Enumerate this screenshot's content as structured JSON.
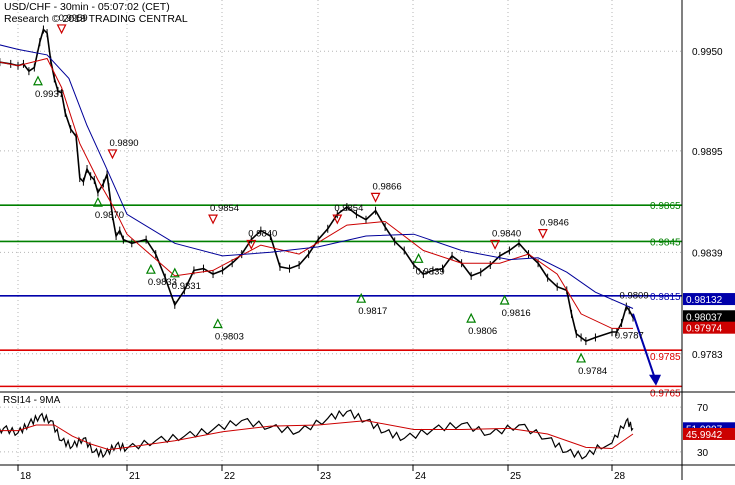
{
  "header": {
    "line1": "USD/CHF - 30min - 05:07:02 (CET)",
    "line2": "Research © 2018 TRADING CENTRAL"
  },
  "colors": {
    "support": "#008000",
    "pivot": "#0000aa",
    "resistance_red": "#dd0000",
    "ema_fast": "#cc0000",
    "ema_slow": "#000099",
    "price": "#000000",
    "grid": "#b5b5b5",
    "current_tag": "#000000",
    "red_tag": "#cc0000",
    "blue_tag": "#0000aa",
    "rsi_tag": "#0000aa",
    "rsi_ma_tag": "#cc0000"
  },
  "chart_data": [
    {
      "type": "line",
      "name": "price",
      "ylim": [
        0.9763,
        0.997
      ],
      "y_ticks": [
        "0.9950",
        "0.9895",
        "0.9839",
        "0.9783"
      ],
      "x_ticks": [
        "18",
        "21",
        "22",
        "23",
        "24",
        "25",
        "28"
      ],
      "price_path": [
        [
          17.0,
          0.9945
        ],
        [
          17.2,
          0.9948
        ],
        [
          17.5,
          0.9944
        ],
        [
          17.8,
          0.9943
        ],
        [
          18.0,
          0.9942
        ],
        [
          18.15,
          0.9943
        ],
        [
          18.3,
          0.9939
        ],
        [
          18.45,
          0.9941
        ],
        [
          18.6,
          0.9955
        ],
        [
          18.7,
          0.9962
        ],
        [
          18.8,
          0.996
        ],
        [
          18.9,
          0.9945
        ],
        [
          19.0,
          0.9935
        ],
        [
          19.1,
          0.9928
        ],
        [
          19.2,
          0.9927
        ],
        [
          19.3,
          0.9916
        ],
        [
          19.45,
          0.9907
        ],
        [
          19.6,
          0.9903
        ],
        [
          19.7,
          0.988
        ],
        [
          19.8,
          0.9878
        ],
        [
          19.9,
          0.9885
        ],
        [
          20.0,
          0.9881
        ],
        [
          20.1,
          0.9879
        ],
        [
          20.2,
          0.9872
        ],
        [
          20.35,
          0.9877
        ],
        [
          20.45,
          0.9882
        ],
        [
          20.5,
          0.9875
        ],
        [
          20.6,
          0.9859
        ],
        [
          20.7,
          0.9848
        ],
        [
          20.8,
          0.9851
        ],
        [
          20.9,
          0.9846
        ],
        [
          21.05,
          0.9844
        ],
        [
          21.2,
          0.9846
        ],
        [
          21.3,
          0.9838
        ],
        [
          21.4,
          0.9825
        ],
        [
          21.5,
          0.981
        ],
        [
          21.6,
          0.9818
        ],
        [
          21.7,
          0.9829
        ],
        [
          21.8,
          0.983
        ],
        [
          21.9,
          0.9827
        ],
        [
          22.0,
          0.9829
        ],
        [
          22.1,
          0.9833
        ],
        [
          22.2,
          0.9838
        ],
        [
          22.3,
          0.9846
        ],
        [
          22.4,
          0.9851
        ],
        [
          22.5,
          0.9848
        ],
        [
          22.6,
          0.9831
        ],
        [
          22.7,
          0.983
        ],
        [
          22.8,
          0.9832
        ],
        [
          22.9,
          0.9838
        ],
        [
          23.0,
          0.9846
        ],
        [
          23.1,
          0.9852
        ],
        [
          23.2,
          0.986
        ],
        [
          23.3,
          0.9864
        ],
        [
          23.4,
          0.986
        ],
        [
          23.5,
          0.9857
        ],
        [
          23.6,
          0.9862
        ],
        [
          23.7,
          0.9853
        ],
        [
          23.8,
          0.9845
        ],
        [
          23.9,
          0.984
        ],
        [
          24.0,
          0.9832
        ],
        [
          24.1,
          0.9827
        ],
        [
          24.2,
          0.9829
        ],
        [
          24.3,
          0.983
        ],
        [
          24.4,
          0.9837
        ],
        [
          24.5,
          0.9833
        ],
        [
          24.6,
          0.9826
        ],
        [
          24.7,
          0.9828
        ],
        [
          24.8,
          0.9832
        ],
        [
          24.9,
          0.9837
        ],
        [
          25.0,
          0.984
        ],
        [
          25.1,
          0.9844
        ],
        [
          25.2,
          0.9838
        ],
        [
          25.3,
          0.9833
        ],
        [
          25.4,
          0.9825
        ],
        [
          25.5,
          0.982
        ],
        [
          25.6,
          0.9818
        ],
        [
          25.65,
          0.9805
        ],
        [
          25.7,
          0.9794
        ],
        [
          25.75,
          0.9792
        ],
        [
          25.8,
          0.979
        ],
        [
          25.9,
          0.9792
        ],
        [
          26.0,
          0.9795
        ],
        [
          26.05,
          0.9795
        ],
        [
          26.1,
          0.98
        ],
        [
          26.15,
          0.9809
        ],
        [
          26.18,
          0.9807
        ],
        [
          26.22,
          0.9803
        ]
      ],
      "ema_fast": [
        [
          17.0,
          0.9946
        ],
        [
          18.0,
          0.9942
        ],
        [
          18.8,
          0.9946
        ],
        [
          19.2,
          0.993
        ],
        [
          19.7,
          0.9899
        ],
        [
          20.2,
          0.9879
        ],
        [
          20.6,
          0.9865
        ],
        [
          21.0,
          0.9849
        ],
        [
          21.5,
          0.9826
        ],
        [
          21.9,
          0.9829
        ],
        [
          22.4,
          0.9843
        ],
        [
          22.8,
          0.9838
        ],
        [
          23.3,
          0.9854
        ],
        [
          23.7,
          0.9856
        ],
        [
          24.1,
          0.984
        ],
        [
          24.5,
          0.9833
        ],
        [
          24.9,
          0.9833
        ],
        [
          25.2,
          0.9838
        ],
        [
          25.5,
          0.9827
        ],
        [
          25.75,
          0.9805
        ],
        [
          26.0,
          0.9797
        ],
        [
          26.22,
          0.9797
        ]
      ],
      "ema_slow": [
        [
          17.0,
          0.9956
        ],
        [
          18.0,
          0.9951
        ],
        [
          18.8,
          0.9948
        ],
        [
          19.4,
          0.9935
        ],
        [
          19.9,
          0.9909
        ],
        [
          20.4,
          0.9887
        ],
        [
          21.0,
          0.986
        ],
        [
          21.5,
          0.9844
        ],
        [
          22.0,
          0.9837
        ],
        [
          22.5,
          0.9839
        ],
        [
          23.0,
          0.9842
        ],
        [
          23.5,
          0.9848
        ],
        [
          24.0,
          0.9849
        ],
        [
          24.5,
          0.984
        ],
        [
          25.0,
          0.9835
        ],
        [
          25.3,
          0.9836
        ],
        [
          25.6,
          0.9828
        ],
        [
          25.9,
          0.9817
        ],
        [
          26.22,
          0.9808
        ]
      ],
      "forecast_arrow": [
        [
          26.22,
          0.9805
        ],
        [
          26.45,
          0.9767
        ]
      ],
      "levels": [
        {
          "value": 0.9865,
          "label": "0.9865",
          "role": "support"
        },
        {
          "value": 0.9845,
          "label": "0.9845",
          "role": "support"
        },
        {
          "value": 0.9815,
          "label": "0.9815",
          "role": "pivot"
        },
        {
          "value": 0.9785,
          "label": "0.9785",
          "role": "resistance_red"
        },
        {
          "value": 0.9765,
          "label": "0.9765",
          "role": "resistance_red"
        }
      ],
      "value_tags": [
        {
          "value": 0.98132,
          "label": "0.98132",
          "style": "blue_tag"
        },
        {
          "value": 0.98037,
          "label": "0.98037",
          "style": "current_tag"
        },
        {
          "value": 0.97974,
          "label": "0.97974",
          "style": "red_tag"
        }
      ],
      "annotations": [
        {
          "x": 18.55,
          "y": 0.9937,
          "label": "0.9937",
          "dir": "low"
        },
        {
          "x": 19.2,
          "y": 0.9959,
          "label": "0.9959",
          "dir": "high"
        },
        {
          "x": 20.6,
          "y": 0.989,
          "label": "0.9890",
          "dir": "high"
        },
        {
          "x": 20.2,
          "y": 0.987,
          "label": "0.9870",
          "dir": "low"
        },
        {
          "x": 21.25,
          "y": 0.9833,
          "label": "0.9833",
          "dir": "low"
        },
        {
          "x": 21.5,
          "y": 0.9831,
          "label": "0.9831",
          "dir": "low"
        },
        {
          "x": 21.9,
          "y": 0.9854,
          "label": "0.9854",
          "dir": "high"
        },
        {
          "x": 22.3,
          "y": 0.984,
          "label": "0.9840",
          "dir": "high"
        },
        {
          "x": 21.95,
          "y": 0.9803,
          "label": "0.9803",
          "dir": "low"
        },
        {
          "x": 23.2,
          "y": 0.9854,
          "label": "0.9854",
          "dir": "high"
        },
        {
          "x": 23.6,
          "y": 0.9866,
          "label": "0.9866",
          "dir": "high"
        },
        {
          "x": 23.45,
          "y": 0.9817,
          "label": "0.9817",
          "dir": "low"
        },
        {
          "x": 24.05,
          "y": 0.9839,
          "label": "0.9839",
          "dir": "low"
        },
        {
          "x": 24.85,
          "y": 0.984,
          "label": "0.9840",
          "dir": "high"
        },
        {
          "x": 25.35,
          "y": 0.9846,
          "label": "0.9846",
          "dir": "high"
        },
        {
          "x": 24.6,
          "y": 0.9806,
          "label": "0.9806",
          "dir": "low"
        },
        {
          "x": 24.95,
          "y": 0.9816,
          "label": "0.9816",
          "dir": "low"
        },
        {
          "x": 26.1,
          "y": 0.9809,
          "label": "0.9809",
          "dir": "none"
        },
        {
          "x": 25.75,
          "y": 0.9784,
          "label": "0.9784",
          "dir": "low"
        },
        {
          "x": 26.05,
          "y": 0.9787,
          "label": "0.9787",
          "dir": "none"
        }
      ]
    },
    {
      "type": "line",
      "name": "RSI14 - 9MA",
      "title": "RSI14 - 9MA",
      "ylim": [
        20,
        80
      ],
      "y_ticks": [
        "70",
        "30"
      ],
      "rsi": [
        [
          17.0,
          50
        ],
        [
          17.3,
          46
        ],
        [
          17.6,
          51
        ],
        [
          18.0,
          47
        ],
        [
          18.3,
          55
        ],
        [
          18.6,
          62
        ],
        [
          18.9,
          58
        ],
        [
          19.2,
          40
        ],
        [
          19.5,
          35
        ],
        [
          19.8,
          42
        ],
        [
          20.1,
          30
        ],
        [
          20.4,
          28
        ],
        [
          20.7,
          36
        ],
        [
          21.0,
          33
        ],
        [
          21.3,
          40
        ],
        [
          21.6,
          44
        ],
        [
          21.9,
          50
        ],
        [
          22.2,
          58
        ],
        [
          22.5,
          52
        ],
        [
          22.8,
          48
        ],
        [
          23.1,
          60
        ],
        [
          23.3,
          66
        ],
        [
          23.5,
          58
        ],
        [
          23.7,
          48
        ],
        [
          23.9,
          42
        ],
        [
          24.2,
          50
        ],
        [
          24.5,
          55
        ],
        [
          24.8,
          46
        ],
        [
          25.1,
          54
        ],
        [
          25.4,
          42
        ],
        [
          25.6,
          30
        ],
        [
          25.8,
          26
        ],
        [
          26.0,
          38
        ],
        [
          26.15,
          58
        ],
        [
          26.22,
          51.0807
        ]
      ],
      "rsi_ma": [
        [
          17.0,
          50
        ],
        [
          17.5,
          49
        ],
        [
          18.0,
          49
        ],
        [
          18.5,
          54
        ],
        [
          19.0,
          54
        ],
        [
          19.5,
          44
        ],
        [
          20.0,
          37
        ],
        [
          20.5,
          32
        ],
        [
          21.0,
          34
        ],
        [
          21.5,
          40
        ],
        [
          22.0,
          48
        ],
        [
          22.5,
          53
        ],
        [
          23.0,
          54
        ],
        [
          23.5,
          58
        ],
        [
          24.0,
          50
        ],
        [
          24.5,
          50
        ],
        [
          25.0,
          51
        ],
        [
          25.4,
          46
        ],
        [
          25.8,
          34
        ],
        [
          26.0,
          33
        ],
        [
          26.22,
          45.9942
        ]
      ],
      "value_tags": [
        {
          "value": 51.0807,
          "label": "51.0807",
          "style": "rsi_tag"
        },
        {
          "value": 45.9942,
          "label": "45.9942",
          "style": "rsi_ma_tag"
        }
      ]
    }
  ]
}
